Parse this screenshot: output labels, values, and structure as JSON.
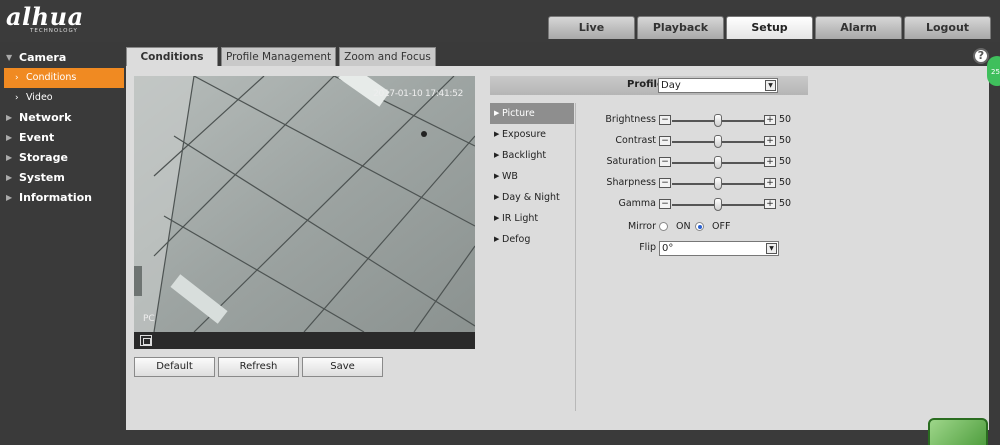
{
  "brand": {
    "logo": "alhua",
    "sub": "TECHNOLOGY"
  },
  "topnav": [
    {
      "label": "Live",
      "active": false
    },
    {
      "label": "Playback",
      "active": false
    },
    {
      "label": "Setup",
      "active": true
    },
    {
      "label": "Alarm",
      "active": false
    },
    {
      "label": "Logout",
      "active": false
    }
  ],
  "sidebar": {
    "camera": "Camera",
    "conditions": "Conditions",
    "video": "Video",
    "network": "Network",
    "event": "Event",
    "storage": "Storage",
    "system": "System",
    "information": "Information"
  },
  "subtabs": {
    "conditions": "Conditions",
    "profile": "Profile Management",
    "zoom": "Zoom and Focus"
  },
  "video": {
    "timestamp": "2017-01-10 17:41:52",
    "label": "PC"
  },
  "buttons": {
    "default": "Default",
    "refresh": "Refresh",
    "save": "Save"
  },
  "profile": {
    "label": "Profile",
    "value": "Day"
  },
  "menu": {
    "picture": "Picture",
    "exposure": "Exposure",
    "backlight": "Backlight",
    "wb": "WB",
    "daynight": "Day & Night",
    "irlight": "IR Light",
    "defog": "Defog"
  },
  "picture": {
    "brightness": {
      "label": "Brightness",
      "value": "50",
      "level": 50
    },
    "contrast": {
      "label": "Contrast",
      "value": "50",
      "level": 50
    },
    "saturation": {
      "label": "Saturation",
      "value": "50",
      "level": 50
    },
    "sharpness": {
      "label": "Sharpness",
      "value": "50",
      "level": 50
    },
    "gamma": {
      "label": "Gamma",
      "value": "50",
      "level": 50
    },
    "mirror": {
      "label": "Mirror",
      "on": "ON",
      "off": "OFF",
      "selected": "OFF"
    },
    "flip": {
      "label": "Flip",
      "value": "0°"
    }
  },
  "badge": "25"
}
